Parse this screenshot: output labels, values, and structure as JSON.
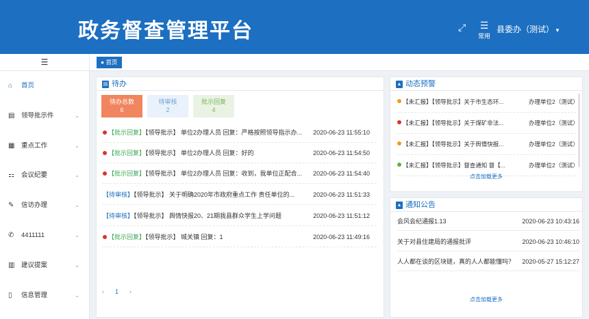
{
  "header": {
    "title": "政务督查管理平台",
    "fullscreen_icon": "⤢",
    "menu_icon": "☰",
    "menu_label": "常用",
    "user": "县委办（测试）",
    "caret": "▼"
  },
  "sidebar": {
    "toggle_icon": "☰",
    "items": [
      {
        "label": "首页",
        "icon": "⌂",
        "chevron": ""
      },
      {
        "label": "领导批示件",
        "icon": "▤",
        "chevron": "⌄"
      },
      {
        "label": "重点工作",
        "icon": "▦",
        "chevron": "⌄"
      },
      {
        "label": "会议纪要",
        "icon": "⚏",
        "chevron": "⌄"
      },
      {
        "label": "信访办理",
        "icon": "✎",
        "chevron": "⌄"
      },
      {
        "label": "4411111",
        "icon": "✆",
        "chevron": "⌄"
      },
      {
        "label": "建议提案",
        "icon": "▥",
        "chevron": "⌄"
      },
      {
        "label": "信息管理",
        "icon": "▯",
        "chevron": "⌄"
      }
    ]
  },
  "tabs": {
    "home": "● 首页"
  },
  "todo": {
    "title": "待办",
    "head_icon": "▤",
    "stats": [
      {
        "label": "待办总数",
        "count": "6"
      },
      {
        "label": "待审核",
        "count": "2"
      },
      {
        "label": "批示回复",
        "count": "4"
      }
    ],
    "rows": [
      {
        "status": "【批示回复】",
        "text": "【领导批示】 单位2办理人员 回复：严格按照领导指示办...",
        "time": "2020-06-23 11:55:10"
      },
      {
        "status": "【批示回复】",
        "text": "【领导批示】 单位2办理人员 回复：好的",
        "time": "2020-06-23 11:54:50"
      },
      {
        "status": "【批示回复】",
        "text": "【领导批示】 单位2办理人员 回复：收到，我单位正配合...",
        "time": "2020-06-23 11:54:40"
      },
      {
        "status": "【待审核】",
        "text": "【领导批示】 关于明确2020年市政府重点工作 责任单位的...",
        "time": "2020-06-23 11:51:33"
      },
      {
        "status": "【待审核】",
        "text": "【领导批示】 舆情快报20、21期我县群众学生上学问题",
        "time": "2020-06-23 11:51:12"
      },
      {
        "status": "【批示回复】",
        "text": "【领导批示】 城关镇 回复：1",
        "time": "2020-06-23 11:49:16"
      }
    ],
    "pager": {
      "prev": "‹",
      "current": "1",
      "next": "›"
    }
  },
  "warning": {
    "title": "动态预警",
    "head_icon": "▲",
    "rows": [
      {
        "pin_color": "#f29b1d",
        "text": "【未汇报】【领导批示】关于市生态环...",
        "unit": "办理单位2（测试）"
      },
      {
        "pin_color": "#d9342b",
        "text": "【未汇报】【领导批示】关于煤矿非法...",
        "unit": "办理单位2（测试）"
      },
      {
        "pin_color": "#f29b1d",
        "text": "【未汇报】【领导批示】关于舆情快报...",
        "unit": "办理单位2（测试）"
      },
      {
        "pin_color": "#5bb544",
        "text": "【未汇报】【领导批示】督查通知 督【...",
        "unit": "办理单位2（测试）"
      }
    ],
    "more": "点击加载更多"
  },
  "notice": {
    "title": "通知公告",
    "head_icon": "▲",
    "rows": [
      {
        "text": "会风会纪通报1.13",
        "time": "2020-06-23 10:43:16"
      },
      {
        "text": "关于对县住建局的通报批评",
        "time": "2020-06-23 10:46:10"
      },
      {
        "text": "人人都在谈的区块链，真的人人都能懂吗？",
        "time": "2020-05-27 15:12:27"
      }
    ],
    "more": "点击加载更多"
  }
}
